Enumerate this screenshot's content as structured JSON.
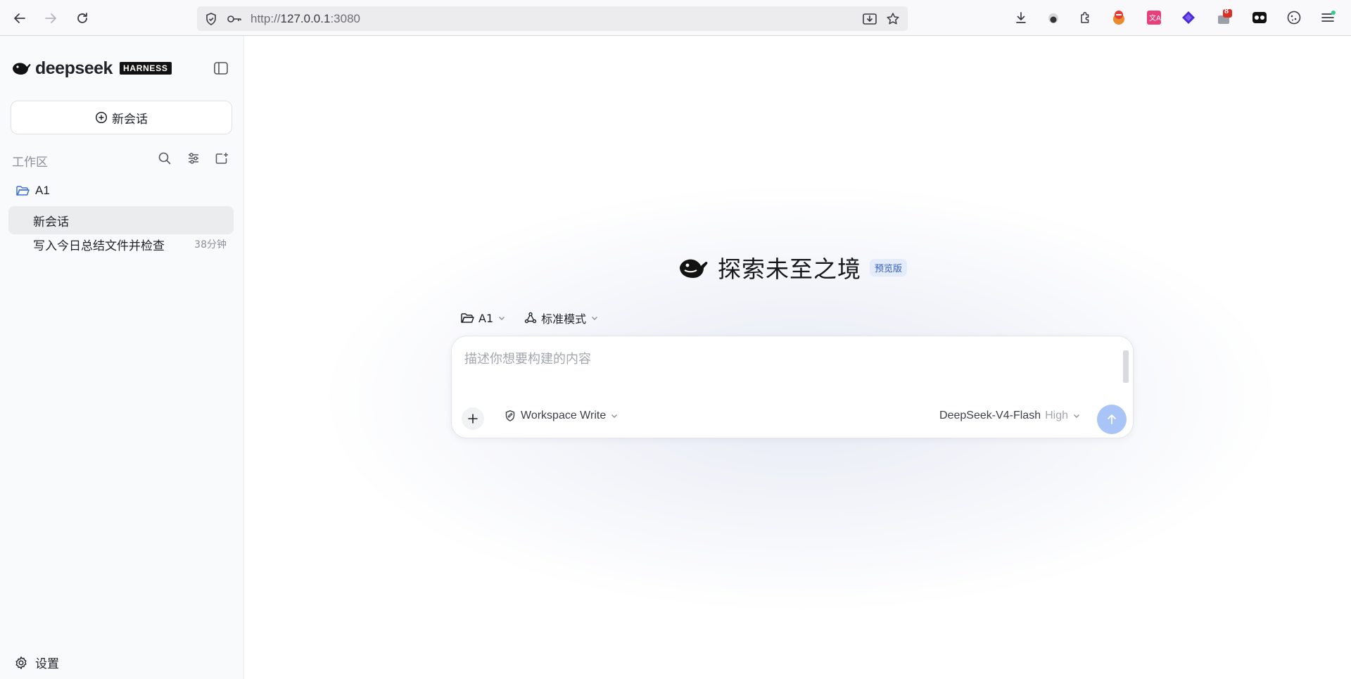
{
  "browser": {
    "url_scheme": "http://",
    "url_host": "127.0.0.1",
    "url_port": ":3080",
    "badge_count": "8"
  },
  "sidebar": {
    "brand_word": "deepseek",
    "brand_tag": "HARNESS",
    "new_chat_label": "新会话",
    "section_label": "工作区",
    "folder_name": "A1",
    "conversations": [
      {
        "title": "新会话",
        "time": ""
      },
      {
        "title": "写入今日总结文件并检查",
        "time": "38分钟"
      }
    ],
    "settings_label": "设置"
  },
  "main": {
    "hero_title": "探索未至之境",
    "hero_badge": "预览版",
    "context_folder": "A1",
    "mode_label": "标准模式",
    "composer_placeholder": "描述你想要构建的内容",
    "permission_label": "Workspace Write",
    "model_name": "DeepSeek-V4-Flash",
    "effort_label": "High"
  },
  "colors": {
    "send_button": "#a9c4f6",
    "badge_bg": "#e4ecfb",
    "badge_text": "#2f5cc4",
    "folder_icon": "#3a6fd8"
  }
}
